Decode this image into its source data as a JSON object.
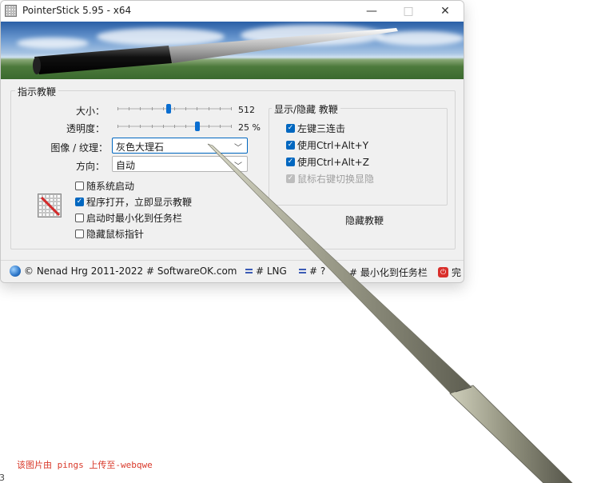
{
  "window": {
    "title": "PointerStick 5.95 - x64",
    "minimize_glyph": "—",
    "maximize_glyph": "□",
    "close_glyph": "✕"
  },
  "pointer_group": {
    "title": "指示教鞭",
    "size_label": "大小：",
    "size_value": "512",
    "size_level": 0.45,
    "opacity_label": "透明度：",
    "opacity_value": "25 %",
    "opacity_level": 0.7,
    "image_label": "图像 / 纹理：",
    "image_value": "灰色大理石",
    "direction_label": "方向：",
    "direction_value": "自动",
    "options": [
      {
        "label": "随系统启动",
        "checked": false
      },
      {
        "label": "程序打开，立即显示教鞭",
        "checked": true
      },
      {
        "label": "启动时最小化到任务栏",
        "checked": false
      },
      {
        "label": "隐藏鼠标指针",
        "checked": false
      }
    ]
  },
  "show_hide_group": {
    "title": "显示/隐藏 教鞭",
    "options": [
      {
        "label": "左键三连击",
        "checked": true,
        "disabled": false
      },
      {
        "label": "使用Ctrl+Alt+Y",
        "checked": true,
        "disabled": false
      },
      {
        "label": "使用Ctrl+Alt+Z",
        "checked": true,
        "disabled": false
      },
      {
        "label": "鼠标右键切换显隐",
        "checked": true,
        "disabled": true
      }
    ],
    "hide_button": "隐藏教鞭"
  },
  "statusbar": {
    "copyright": "© Nenad Hrg 2011-2022 # SoftwareOK.com",
    "lng": "# LNG",
    "help": "# ?",
    "minimize": "# 最小化到任务栏",
    "exit": "完"
  },
  "watermark": "该图片由 pings 上传至-webqwe",
  "corner_number": "3",
  "colors": {
    "accent": "#0067c0",
    "slider_thumb": "#0a6ed1",
    "watermark": "#d93a2b"
  }
}
